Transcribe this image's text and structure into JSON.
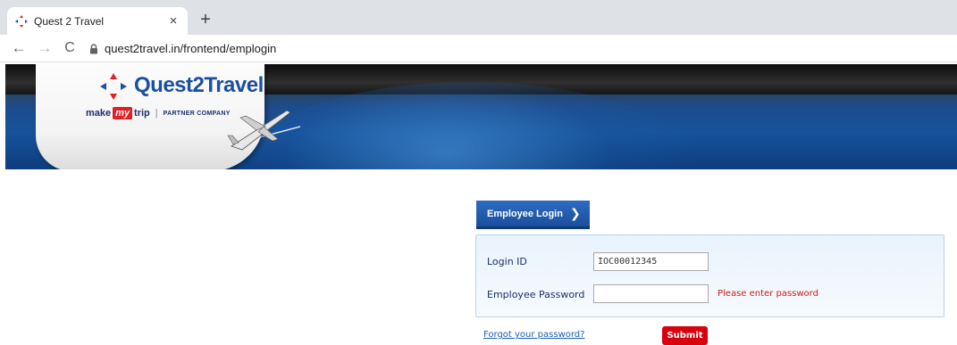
{
  "browser": {
    "tab_title": "Quest 2 Travel",
    "tab_close": "×",
    "new_tab": "+",
    "back": "←",
    "forward": "→",
    "reload": "C",
    "url": "quest2travel.in/frontend/emplogin"
  },
  "header": {
    "logo_text": "Quest2Travel",
    "make": "make",
    "my": "my",
    "trip": "trip",
    "separator": "|",
    "partner": "PARTNER COMPANY"
  },
  "login": {
    "tab_label": "Employee Login",
    "tab_chevron": "❯",
    "login_id_label": "Login ID",
    "login_id_value": "IOC00012345",
    "password_label": "Employee Password",
    "password_value": "",
    "password_error": "Please enter password",
    "forgot_link": "Forgot your password?",
    "submit_label": "Submit"
  },
  "colors": {
    "brand_blue": "#1b4fa0",
    "submit_red": "#d9000d",
    "error_red": "#d11a1a"
  }
}
